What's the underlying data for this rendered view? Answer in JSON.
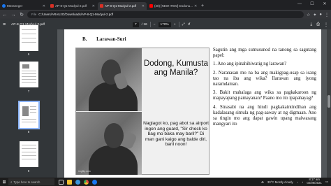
{
  "browser": {
    "tabs": [
      {
        "label": "Messenger",
        "favicon_color": "#1877f2"
      },
      {
        "label": "AP-8-Q1-Modyul-2.pdf",
        "favicon_color": "#d93025"
      },
      {
        "label": "AP-8-Q1-Modyul-2.pdf",
        "favicon_color": "#d93025",
        "active": true
      },
      {
        "label": "(20) [NEW ITEM] Dodonu...",
        "favicon_color": "#ff0000"
      }
    ],
    "new_tab": "+",
    "address": {
      "prefix": "File",
      "path": "C:/Users/ARAUJO/Downloads/AP-8-Q1-Modyul-2.pdf"
    }
  },
  "pdf_toolbar": {
    "title": "AP-8-Q1-Modyul-2.pdf",
    "page_current": "7",
    "page_total": "/ 16",
    "zoom": "170%"
  },
  "thumbnails": [
    {
      "num": "6",
      "selected": false
    },
    {
      "num": "7",
      "selected": false
    },
    {
      "num": "8",
      "selected": true
    },
    {
      "num": "9",
      "selected": false
    }
  ],
  "document": {
    "section_letter": "B.",
    "section_heading": "Larawan-Suri",
    "meme_top_text": "Dodong, Kumusta ang Manila?",
    "meme_bottom_text": "Naglagot ko, pag abot sa airport ingon ang guard, \"Sir check ko bag mo baka may baril?\" Di man gani kaigo ang balde diri, baril noon!",
    "meme_watermark": "imgflip.com",
    "instructions_intro": "Sagutin ang mga sumusunod na tanong sa sagutang papel:",
    "q1": "1. Ano ang ipinahihiwatig ng larawan?",
    "q2": "2. Naranasan mo na ba ang makigpag-usap sa isang tao na iba ang wika? Ilarawan ang iyong naramdaman.",
    "q3": "3. Bakit mahalaga ang wika sa pagkakaroon ng mapayapang pamayanan? Paano mo ito ipapahayag?",
    "q4": "4. Sinasabi na ang hindi pagkakaintindihan ang kadalasang simula ng pag-aaway at ng digmaan. Ano sa tingin mo ang dapat gawin upang maiwasang mangyari ito"
  },
  "taskbar": {
    "search_placeholder": "Type here to search",
    "weather": "30°C Mostly cloudy",
    "time": "8:17 am",
    "date": "02/09/2021",
    "icon_colors": [
      "#f0c030",
      "#3a96dd",
      "#e8453c",
      "#34a853",
      "#1877f2"
    ]
  }
}
